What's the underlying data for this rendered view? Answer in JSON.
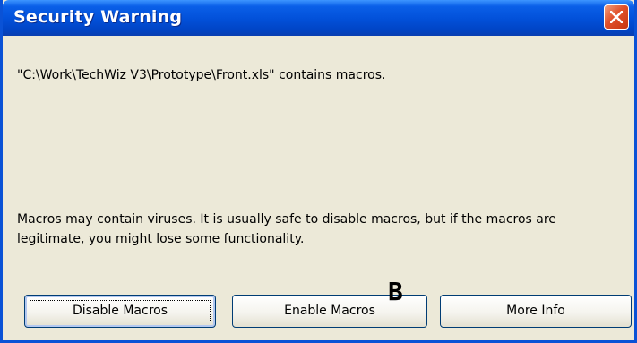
{
  "dialog": {
    "title": "Security Warning",
    "message": "\"C:\\Work\\TechWiz V3\\Prototype\\Front.xls\" contains macros.",
    "warning": "Macros may contain viruses. It is usually safe to disable macros, but if the macros are legitimate, you might lose some functionality."
  },
  "buttons": {
    "disable_label": "Disable Macros",
    "enable_label": "Enable Macros",
    "more_info_label": "More Info"
  },
  "annotation": {
    "marker_label": "B"
  },
  "colors": {
    "titlebar": "#0250d8",
    "window_bg": "#ece9d8",
    "close_button": "#e0502a"
  }
}
